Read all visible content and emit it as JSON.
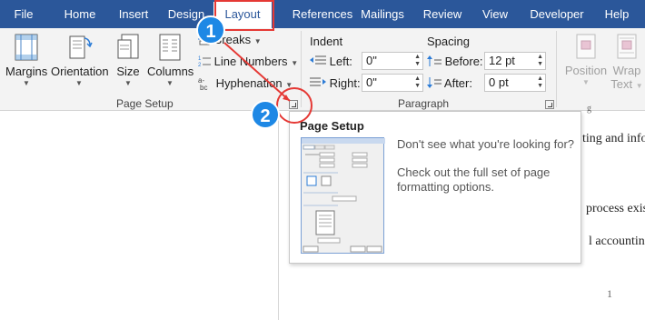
{
  "tabs": [
    {
      "label": "File"
    },
    {
      "label": "Home"
    },
    {
      "label": "Insert"
    },
    {
      "label": "Design"
    },
    {
      "label": "Layout"
    },
    {
      "label": "References"
    },
    {
      "label": "Mailings"
    },
    {
      "label": "Review"
    },
    {
      "label": "View"
    },
    {
      "label": "Developer"
    },
    {
      "label": "Help"
    }
  ],
  "colors": {
    "tabbar": "#2b579a",
    "accent_red": "#e53935",
    "badge_blue": "#1e88e5"
  },
  "page_setup": {
    "margins": "Margins",
    "orientation": "Orientation",
    "size": "Size",
    "columns": "Columns",
    "breaks": "Breaks",
    "line_numbers": "Line Numbers",
    "hyphenation": "Hyphenation",
    "group_label": "Page Setup"
  },
  "paragraph": {
    "indent_label": "Indent",
    "spacing_label": "Spacing",
    "left_label": "Left:",
    "left_value": "0\"",
    "right_label": "Right:",
    "right_value": "0\"",
    "before_label": "Before:",
    "before_value": "12 pt",
    "after_label": "After:",
    "after_value": "0 pt",
    "group_label": "Paragraph"
  },
  "arrange": {
    "position": "Position",
    "wrap_text_line1": "Wrap",
    "wrap_text_line2": "Text"
  },
  "tooltip": {
    "title": "Page Setup",
    "line1": "Don't see what you're looking for?",
    "line2": "Check out the full set of page formatting options."
  },
  "document": {
    "fragment1": "ting and info",
    "fragment2": "process exis",
    "fragment3": "l accounting",
    "page_number": "1"
  },
  "annotations": {
    "step1": "1",
    "step2": "2"
  },
  "icons": [
    "margins-icon",
    "orientation-icon",
    "size-icon",
    "columns-icon",
    "breaks-icon",
    "line-numbers-icon",
    "hyphenation-icon",
    "indent-left-icon",
    "indent-right-icon",
    "spacing-before-icon",
    "spacing-after-icon",
    "position-icon",
    "wrap-text-icon",
    "dialog-launcher-icon"
  ]
}
